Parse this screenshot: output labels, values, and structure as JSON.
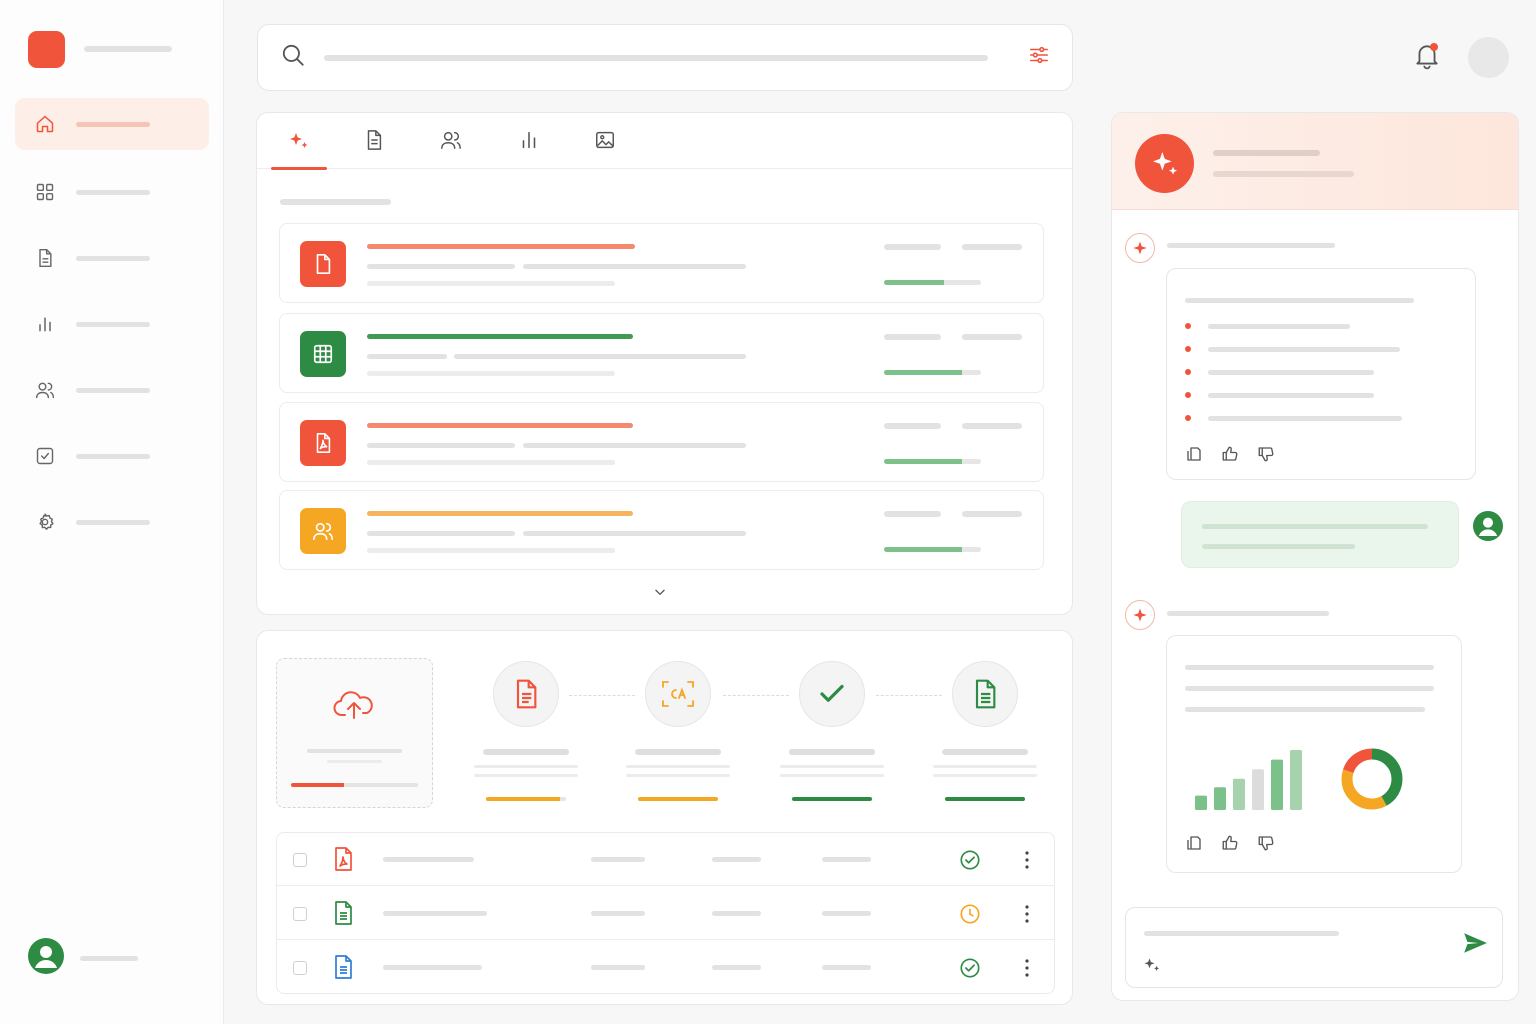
{
  "colors": {
    "accent": "#f0543a",
    "green": "#2e8b44",
    "orange": "#f5a623",
    "light_green_bar": "#7cc08a"
  },
  "sidebar": {
    "items": [
      {
        "icon": "home-icon",
        "active": true
      },
      {
        "icon": "grid-icon",
        "active": false
      },
      {
        "icon": "document-icon",
        "active": false
      },
      {
        "icon": "bar-chart-icon",
        "active": false
      },
      {
        "icon": "users-icon",
        "active": false
      },
      {
        "icon": "checkbox-icon",
        "active": false
      },
      {
        "icon": "settings-icon",
        "active": false
      }
    ],
    "footer_icon": "user-avatar-icon"
  },
  "header": {
    "search_icon": "search-icon",
    "filter_icon": "filter-sliders-icon",
    "notification_icon": "bell-icon",
    "notification_unread": true
  },
  "files": {
    "tabs": [
      {
        "icon": "sparkle-icon",
        "active": true
      },
      {
        "icon": "document-icon",
        "active": false
      },
      {
        "icon": "users-icon",
        "active": false
      },
      {
        "icon": "bar-chart-icon",
        "active": false
      },
      {
        "icon": "image-icon",
        "active": false
      }
    ],
    "rows": [
      {
        "type": "document",
        "icon": "document-icon",
        "color": "#f0543a",
        "title_color": "#f4896f",
        "progress": 0.62
      },
      {
        "type": "spreadsheet",
        "icon": "spreadsheet-icon",
        "color": "#2e8b44",
        "title_color": "#3f9a54",
        "progress": 0.8
      },
      {
        "type": "pdf",
        "icon": "pdf-icon",
        "color": "#f0543a",
        "title_color": "#f4896f",
        "progress": 0.8
      },
      {
        "type": "contacts",
        "icon": "users-icon",
        "color": "#f5a623",
        "title_color": "#f7b45f",
        "progress": 0.8
      }
    ],
    "expand_icon": "chevron-down-icon"
  },
  "pipeline": {
    "upload_icon": "cloud-upload-icon",
    "upload_progress": 0.42,
    "steps": [
      {
        "icon": "document-icon",
        "progress": 0.93,
        "color": "#f5a623"
      },
      {
        "icon": "ocr-scan-icon",
        "progress": 1.0,
        "color": "#f5a623"
      },
      {
        "icon": "check-icon",
        "progress": 1.0,
        "color": "#2e8b44"
      },
      {
        "icon": "document-icon",
        "progress": 1.0,
        "color": "#2e8b44"
      }
    ]
  },
  "table": {
    "rows": [
      {
        "icon": "pdf-icon",
        "icon_color": "#f0543a",
        "status_icon": "check-circle-icon",
        "status_color": "#2e8b44"
      },
      {
        "icon": "document-icon",
        "icon_color": "#2e8b44",
        "status_icon": "clock-icon",
        "status_color": "#f5a623"
      },
      {
        "icon": "document-icon",
        "icon_color": "#2f7fd8",
        "status_icon": "check-circle-icon",
        "status_color": "#2e8b44"
      }
    ]
  },
  "chat": {
    "assistant_icon": "sparkle-icon",
    "user_icon": "user-avatar-icon",
    "message_actions": [
      "copy-icon",
      "thumbs-up-icon",
      "thumbs-down-icon"
    ],
    "mini_chart": {
      "type": "bar",
      "values": [
        0.24,
        0.38,
        0.52,
        0.68,
        0.84,
        1.0
      ],
      "colors": [
        "#7cc08a",
        "#7cc08a",
        "#a6d3ae",
        "#dcdcdc",
        "#7cc08a",
        "#a6d3ae"
      ]
    },
    "mini_donut": {
      "type": "pie",
      "values": [
        0.42,
        0.38,
        0.2
      ],
      "colors": [
        "#2e8b44",
        "#f5a623",
        "#f0543a"
      ]
    },
    "composer_icon": "sparkle-icon",
    "send_icon": "send-icon"
  }
}
